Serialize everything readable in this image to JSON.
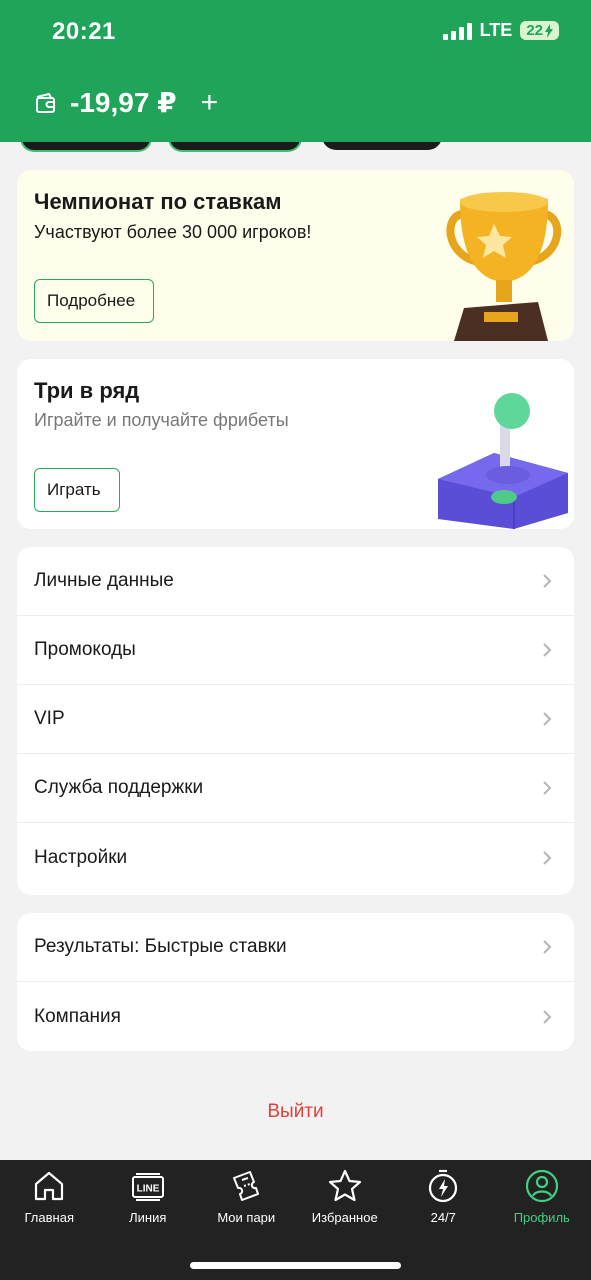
{
  "status_bar": {
    "time": "20:21",
    "network": "LTE",
    "battery": "22"
  },
  "header": {
    "balance": "-19,97 ₽"
  },
  "promos": [
    {
      "title": "Чемпионат по ставкам",
      "subtitle": "Участвуют более 30 000 игроков!",
      "button": "Подробнее"
    },
    {
      "title": "Три в ряд",
      "subtitle": "Играйте и получайте фрибеты",
      "button": "Играть"
    }
  ],
  "menu_main": [
    {
      "label": "Личные данные"
    },
    {
      "label": "Промокоды"
    },
    {
      "label": "VIP"
    },
    {
      "label": "Служба поддержки"
    },
    {
      "label": "Настройки"
    }
  ],
  "menu_secondary": [
    {
      "label": "Результаты: Быстрые ставки"
    },
    {
      "label": "Компания"
    }
  ],
  "logout_label": "Выйти",
  "tabbar": {
    "active": "Профиль",
    "tabs": [
      {
        "label": "Главная",
        "icon": "home-icon"
      },
      {
        "label": "Линия",
        "icon": "line-icon",
        "icon_text": "LINE"
      },
      {
        "label": "Мои пари",
        "icon": "tickets-icon"
      },
      {
        "label": "Избранное",
        "icon": "star-icon"
      },
      {
        "label": "24/7",
        "icon": "stopwatch-bolt-icon"
      },
      {
        "label": "Профиль",
        "icon": "profile-icon"
      }
    ]
  },
  "colors": {
    "brand_green": "#1fa45a",
    "accent_green": "#3fd083",
    "logout_red": "#e0413b",
    "tabbar_bg": "#222222"
  }
}
